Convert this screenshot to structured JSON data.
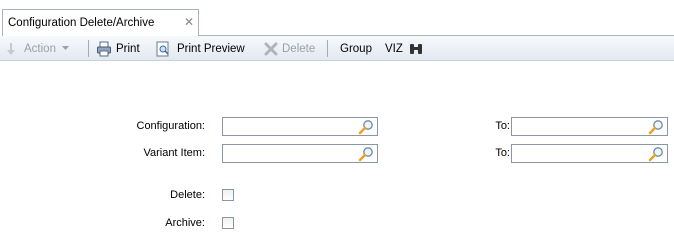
{
  "tab": {
    "title": "Configuration Delete/Archive",
    "close_glyph": "✕"
  },
  "toolbar": {
    "action_label": "Action",
    "print_label": "Print",
    "print_preview_label": "Print Preview",
    "delete_label": "Delete",
    "group_label": "Group",
    "viz_label": "VIZ"
  },
  "form": {
    "configuration_label": "Configuration:",
    "configuration_from_value": "",
    "configuration_to_label": "To:",
    "configuration_to_value": "",
    "variant_item_label": "Variant Item:",
    "variant_item_from_value": "",
    "variant_item_to_label": "To:",
    "variant_item_to_value": "",
    "delete_label": "Delete:",
    "delete_checked": false,
    "archive_label": "Archive:",
    "archive_checked": false
  },
  "colors": {
    "accent": "#f0a020",
    "border": "#8a96a6"
  }
}
